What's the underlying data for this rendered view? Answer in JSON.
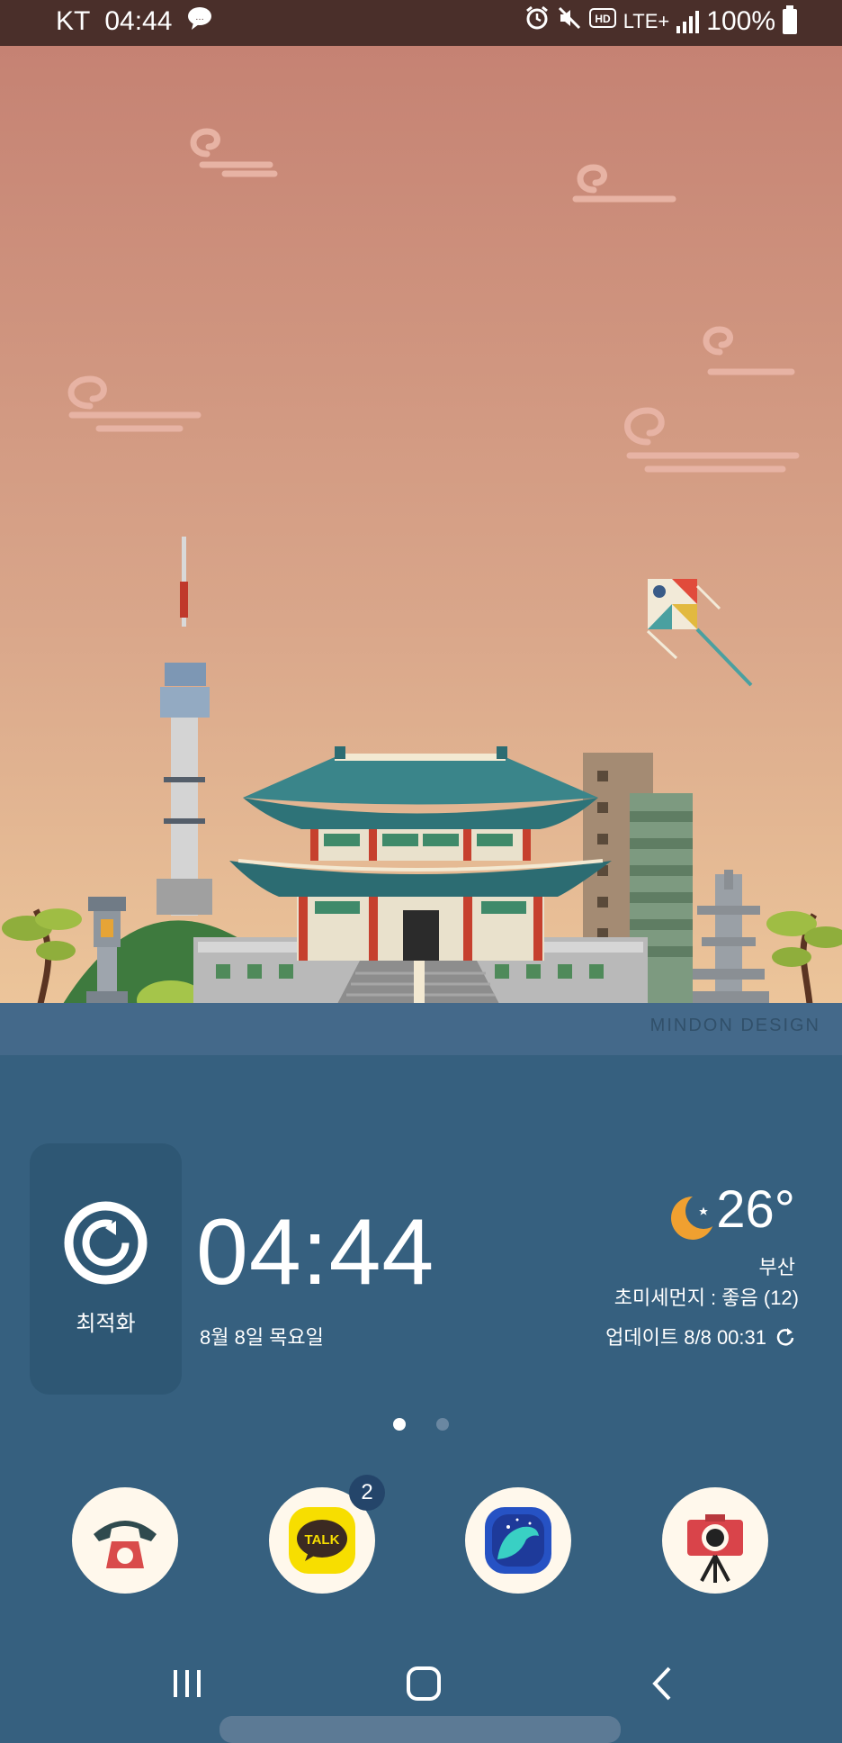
{
  "status_bar": {
    "carrier": "KT",
    "time": "04:44",
    "network": "LTE+",
    "battery": "100%"
  },
  "wallpaper": {
    "watermark": "MINDON DESIGN"
  },
  "widget": {
    "optimize_label": "최적화",
    "clock_time": "04:44",
    "date": "8월 8일 목요일",
    "temperature": "26°",
    "city": "부산",
    "fine_dust": "초미세먼지 : 좋음 (12)",
    "updated": "업데이트 8/8 00:31"
  },
  "pager": {
    "pages": 2,
    "current": 1
  },
  "dock": {
    "apps": [
      {
        "icon": "phone-icon"
      },
      {
        "icon": "kakaotalk-icon",
        "badge": "2"
      },
      {
        "icon": "whale-browser-icon"
      },
      {
        "icon": "camera-icon"
      }
    ],
    "kakao_text": "TALK"
  },
  "navigation": {
    "recents": "recents-icon",
    "home": "home-icon",
    "back": "back-icon"
  },
  "colors": {
    "status_bar": "#4a2f2a",
    "home_background": "#36607f",
    "sky_top": "#c58273",
    "sky_bottom": "#ecc59a"
  }
}
